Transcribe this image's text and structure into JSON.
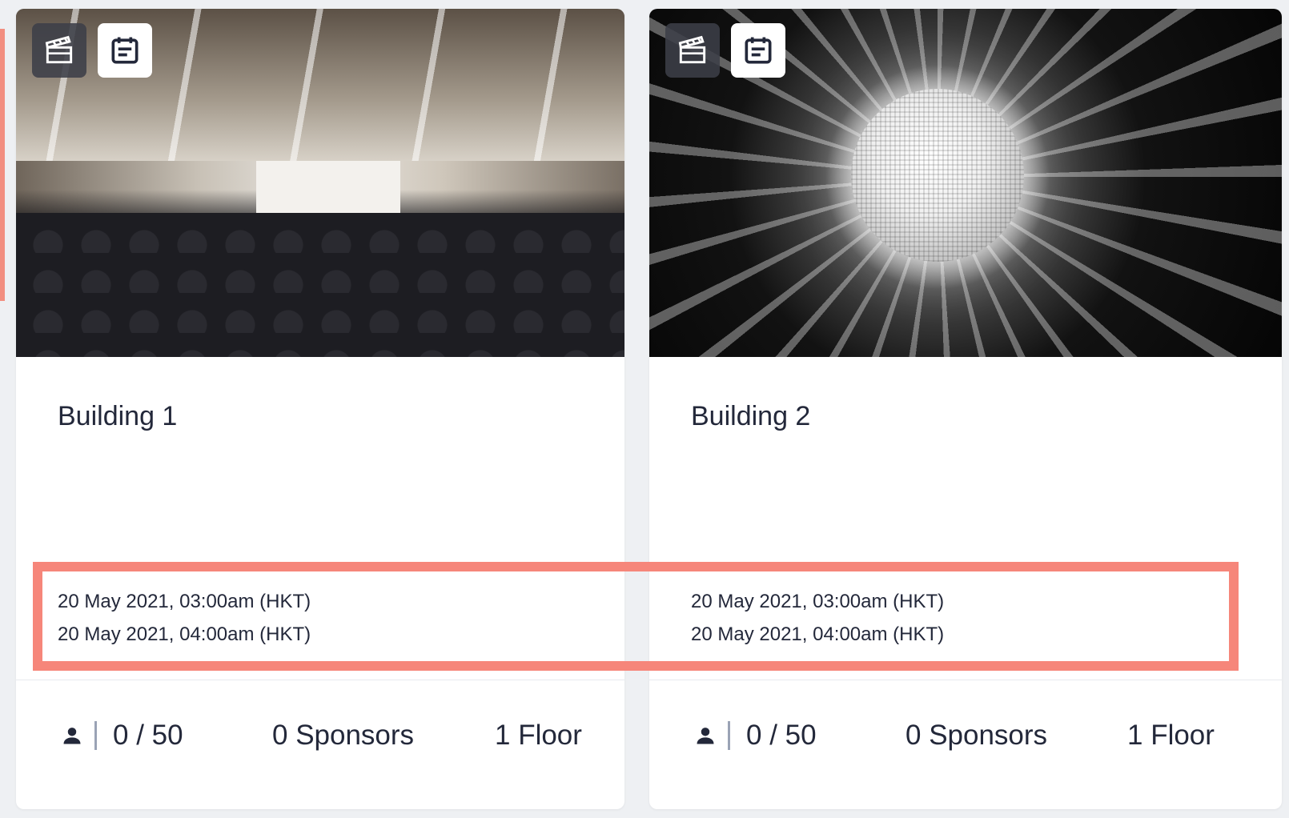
{
  "colors": {
    "highlight_border": "#f6867a",
    "text": "#23283a",
    "background": "#eef0f3",
    "card": "#ffffff"
  },
  "cards": [
    {
      "title": "Building 1",
      "start": "20 May 2021, 03:00am (HKT)",
      "end": "20 May 2021, 04:00am (HKT)",
      "capacity": "0 / 50",
      "sponsors": "0 Sponsors",
      "floors": "1 Floor",
      "badges": [
        "clapperboard-icon",
        "event-note-icon"
      ]
    },
    {
      "title": "Building 2",
      "start": "20 May 2021, 03:00am (HKT)",
      "end": "20 May 2021, 04:00am (HKT)",
      "capacity": "0 / 50",
      "sponsors": "0 Sponsors",
      "floors": "1 Floor",
      "badges": [
        "clapperboard-icon",
        "event-note-icon"
      ]
    }
  ]
}
